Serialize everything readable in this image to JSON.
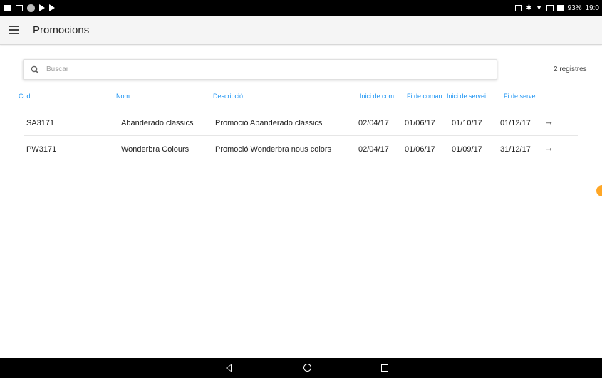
{
  "statusbar": {
    "battery": "93%",
    "time": "19:0"
  },
  "appbar": {
    "title": "Promocions"
  },
  "search": {
    "placeholder": "Buscar",
    "value": ""
  },
  "records": "2 registres",
  "columns": [
    "Codi",
    "Nom",
    "Descripció",
    "Inici de com...",
    "Fi de coman...",
    "Inici de servei",
    "Fi de servei"
  ],
  "rows": [
    {
      "code": "SA3171",
      "name": "Abanderado classics",
      "description": "Promoció Abanderado clàssics",
      "order_start": "02/04/17",
      "order_end": "01/06/17",
      "service_start": "01/10/17",
      "service_end": "01/12/17"
    },
    {
      "code": "PW3171",
      "name": "Wonderbra Colours",
      "description": "Promoció Wonderbra nous colors",
      "order_start": "02/04/17",
      "order_end": "01/06/17",
      "service_start": "01/09/17",
      "service_end": "31/12/17"
    }
  ],
  "icons": {
    "menu": "hamburger-menu-icon",
    "search": "search-icon",
    "row_action": "arrow-right-icon"
  },
  "colors": {
    "header_accent": "#2196f3",
    "appbar_bg": "#f5f5f5",
    "status_bg": "#000000",
    "fab_hint": "#ffa726"
  }
}
